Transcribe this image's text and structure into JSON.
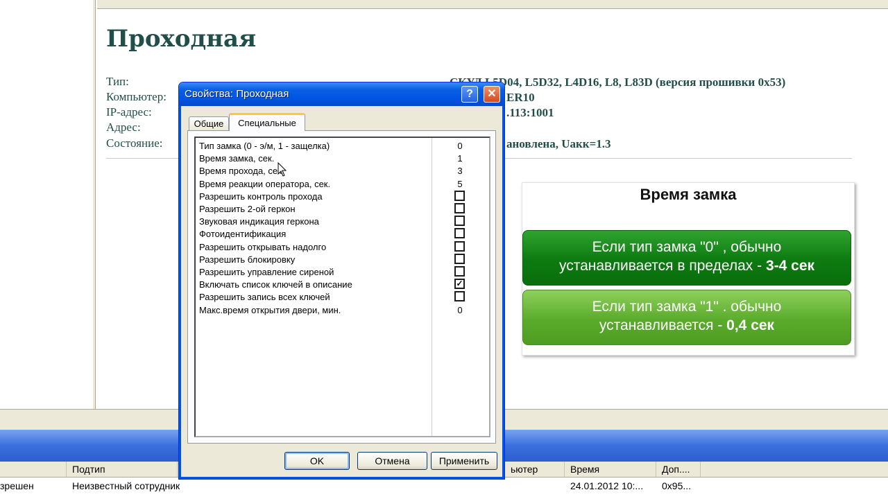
{
  "background": {
    "page_title": "Проходная",
    "info": {
      "labels": [
        "Тип:",
        "Компьютер:",
        "IP-адрес:",
        "Адрес:",
        "Состояние:"
      ],
      "type_value": "СКУД L5D04, L5D32, L4D16, L8, L83D (версия прошивки 0x53)",
      "computer_value": "ER10",
      "ip_value": ".113:1001",
      "state_value": "ановлена, Uакк=1.3"
    },
    "hint": {
      "title": "Время замка",
      "box1_line1": "Если тип  замка \"0\" , обычно",
      "box1_line2_prefix": "устанавливается в пределах - ",
      "box1_line2_bold": "3-4 сек",
      "box2_line1": "Если тип замка \"1\" . обычно",
      "box2_line2_prefix": "устанавливается - ",
      "box2_line2_bold": "0,4 сек"
    },
    "event_list": {
      "headers": [
        "Подтип",
        "ьютер",
        "Время",
        "Доп...."
      ],
      "row": {
        "col0": "зрешен",
        "subtype": "Неизвестный сотрудник",
        "time": "24.01.2012 10:...",
        "extra": "0x95..."
      }
    }
  },
  "dialog": {
    "title": "Свойства: Проходная",
    "help_symbol": "?",
    "close_symbol": "✕",
    "tabs": [
      "Общие",
      "Специальные"
    ],
    "active_tab": "Специальные",
    "properties": [
      {
        "label": "Тип замка (0 - э/м, 1 - защелка)",
        "value": "0"
      },
      {
        "label": "Время замка, сек.",
        "value": "1"
      },
      {
        "label": "Время прохода, сек.",
        "value": "3"
      },
      {
        "label": "Время реакции оператора, сек.",
        "value": "5"
      },
      {
        "label": "Разрешить контроль прохода",
        "checked": false
      },
      {
        "label": "Разрешить 2-ой геркон",
        "checked": false
      },
      {
        "label": "Звуковая индикация геркона",
        "checked": false
      },
      {
        "label": "Фотоидентификация",
        "checked": false
      },
      {
        "label": "Разрешить открывать надолго",
        "checked": false
      },
      {
        "label": "Разрешить блокировку",
        "checked": false
      },
      {
        "label": "Разрешить управление сиреной",
        "checked": false
      },
      {
        "label": "Включать список ключей в описание",
        "checked": true
      },
      {
        "label": "Разрешить запись всех ключей",
        "checked": false
      },
      {
        "label": "Макс.время открытия двери, мин.",
        "value": "0"
      }
    ],
    "buttons": {
      "ok": "OK",
      "cancel": "Отмена",
      "apply": "Применить"
    }
  }
}
